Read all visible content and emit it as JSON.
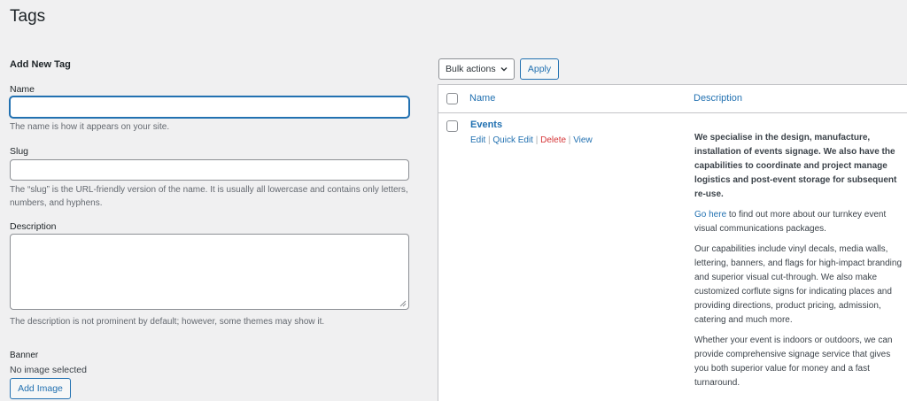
{
  "page": {
    "title": "Tags"
  },
  "form": {
    "heading": "Add New Tag",
    "name_label": "Name",
    "name_value": "",
    "name_help": "The name is how it appears on your site.",
    "slug_label": "Slug",
    "slug_value": "",
    "slug_help": "The “slug” is the URL-friendly version of the name. It is usually all lowercase and contains only letters, numbers, and hyphens.",
    "description_label": "Description",
    "description_help": "The description is not prominent by default; however, some themes may show it.",
    "banner_label": "Banner",
    "banner_status": "No image selected",
    "add_image_label": "Add Image"
  },
  "toolbar": {
    "bulk_actions_label": "Bulk actions",
    "apply_label": "Apply"
  },
  "table": {
    "columns": {
      "name": "Name",
      "description": "Description"
    },
    "rows": [
      {
        "name": "Events",
        "actions": {
          "edit": "Edit",
          "quick_edit": "Quick Edit",
          "delete": "Delete",
          "view": "View",
          "separator": " | "
        },
        "description": {
          "p1": "We specialise in the design, manufacture, installation of events signage. We also have the capabilities to coordinate and project manage logistics and post-event storage for subsequent re-use.",
          "p2_link": "Go here",
          "p2_rest": " to find out more about our turnkey event visual communications packages.",
          "p3": "Our capabilities include vinyl decals, media walls, lettering, banners, and flags for high-impact branding and superior visual cut-through. We also make customized corflute signs for indicating places and providing directions, product pricing, admission, catering and much more.",
          "p4": "Whether your event is indoors or outdoors, we can provide comprehensive signage service that gives you both superior value for money and a fast turnaround."
        }
      }
    ]
  },
  "colors": {
    "accent": "#2271b1",
    "danger": "#d63638",
    "background": "#f0f0f1"
  }
}
